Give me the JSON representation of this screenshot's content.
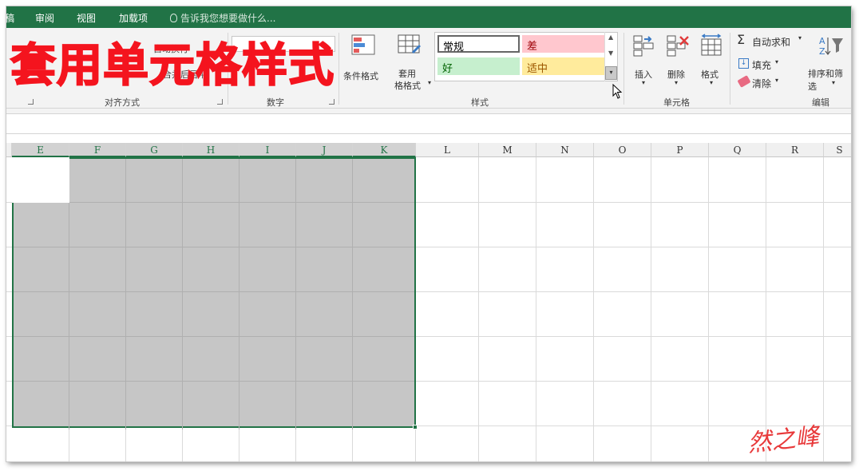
{
  "menu": {
    "partial_tab": "稿",
    "review": "审阅",
    "view": "视图",
    "addins": "加载项",
    "tell_me": "告诉我您想要做什么..."
  },
  "overlay_title": "套用单元格样式",
  "ribbon": {
    "alignment": {
      "label": "对齐方式",
      "wrap_text": "自动换行",
      "merge": "合并后居中"
    },
    "number": {
      "label": "数字"
    },
    "styles": {
      "label": "样式",
      "conditional": "条件格式",
      "table_line1": "套用",
      "table_line2": "格格式",
      "cells": [
        {
          "name": "常规",
          "bg": "#ffffff",
          "fg": "#000000",
          "border": "#666666"
        },
        {
          "name": "差",
          "bg": "#ffc7ce",
          "fg": "#9c0006",
          "border": "#ffc7ce"
        },
        {
          "name": "好",
          "bg": "#c6efce",
          "fg": "#006100",
          "border": "#c6efce"
        },
        {
          "name": "适中",
          "bg": "#ffeb9c",
          "fg": "#9c5700",
          "border": "#ffeb9c"
        }
      ]
    },
    "cells_group": {
      "label": "单元格",
      "insert": "插入",
      "delete": "删除",
      "format": "格式"
    },
    "editing": {
      "label": "编辑",
      "autosum": "自动求和",
      "fill": "填充",
      "clear": "清除",
      "sort_filter": "排序和筛选"
    }
  },
  "columns": [
    "E",
    "F",
    "G",
    "H",
    "I",
    "J",
    "K",
    "L",
    "M",
    "N",
    "O",
    "P",
    "Q",
    "R",
    "S"
  ],
  "selected_columns": [
    "E",
    "F",
    "G",
    "H",
    "I",
    "J",
    "K"
  ],
  "accent": "#217346",
  "signature": "然之峰"
}
